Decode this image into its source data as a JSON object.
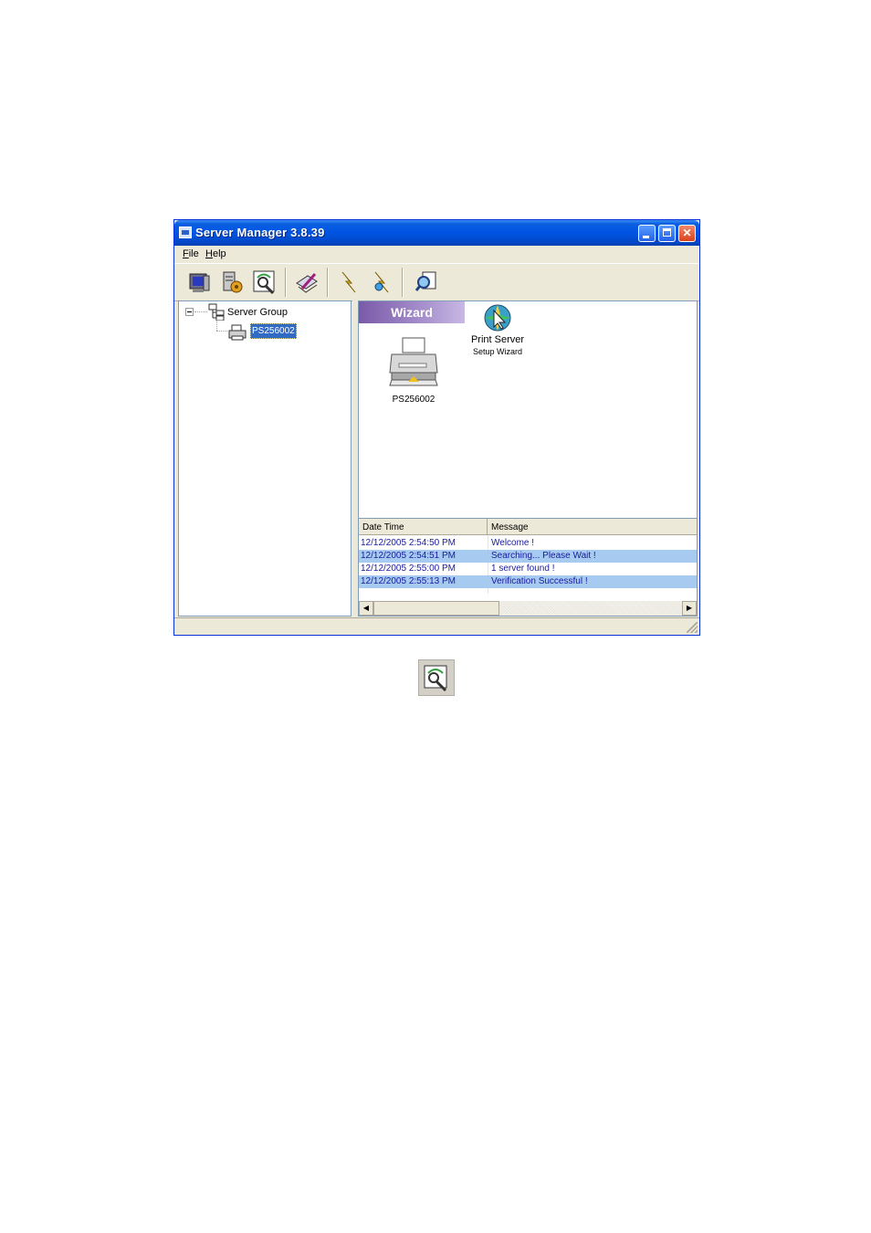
{
  "window": {
    "title": "Server Manager 3.8.39",
    "controls": {
      "minimize_icon": "minimize-icon",
      "maximize_icon": "maximize-icon",
      "close_icon": "close-icon"
    }
  },
  "menu": {
    "items": [
      "File",
      "Help"
    ]
  },
  "toolbar": {
    "buttons": [
      "monitor-icon",
      "server-settings-icon",
      "search-verify-icon",
      "edit-config-icon",
      "flash-upgrade-icon",
      "flash-reset-icon",
      "find-page-icon"
    ]
  },
  "tree": {
    "root_label": "Server Group",
    "child_label": "PS256002"
  },
  "wizard": {
    "banner": "Wizard",
    "printer_label": "PS256002",
    "setup_label_line1": "Print Server",
    "setup_label_line2": "Setup Wizard"
  },
  "log": {
    "headers": {
      "datetime": "Date Time",
      "message": "Message"
    },
    "rows": [
      {
        "datetime": "12/12/2005 2:54:50 PM",
        "message": "Welcome !"
      },
      {
        "datetime": "12/12/2005 2:54:51 PM",
        "message": "Searching... Please Wait !"
      },
      {
        "datetime": "12/12/2005 2:55:00 PM",
        "message": "1 server found !"
      },
      {
        "datetime": "12/12/2005 2:55:13 PM",
        "message": "Verification Successful !"
      }
    ]
  },
  "colors": {
    "titlebar": "#0054e3",
    "selection": "#316ac5",
    "row_highlight": "#a6caf0",
    "log_text": "#1a1aa0",
    "banner": "#7a5aa8"
  }
}
